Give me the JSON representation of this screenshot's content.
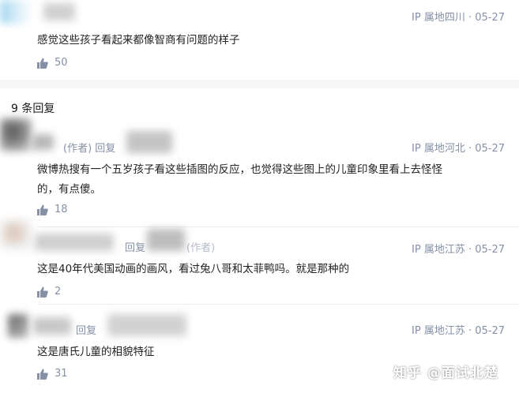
{
  "top_comment": {
    "location": "IP 属地四川 · 05-27",
    "text": "感觉这些孩子看起来都像智商有问题的样子",
    "likes": "50"
  },
  "replies_header": "9 条回复",
  "replies": [
    {
      "author_fragment": "(作者) 回复",
      "location": "IP 属地河北 · 05-27",
      "text_line1": "微博热搜有一个五岁孩子看这些插图的反应，也觉得这些图上的儿童印象里看上去怪怪",
      "text_line2": "的，有点傻。",
      "likes": "18"
    },
    {
      "author_fragment": "回复",
      "author_fragment2": "(作者)",
      "location": "IP 属地江苏 · 05-27",
      "text_line1": "这是40年代美国动画的画风，看过兔八哥和太菲鸭吗。就是那种的",
      "likes": "2"
    },
    {
      "author_fragment": "回复",
      "location": "IP 属地江苏 · 05-27",
      "text_line1": "这是唐氏儿童的相貌特征",
      "likes": "31"
    }
  ],
  "watermark": "知乎 @面试北楚",
  "colors": {
    "meta": "#8590a6",
    "text": "#222222",
    "band": "#f6f6f6"
  }
}
